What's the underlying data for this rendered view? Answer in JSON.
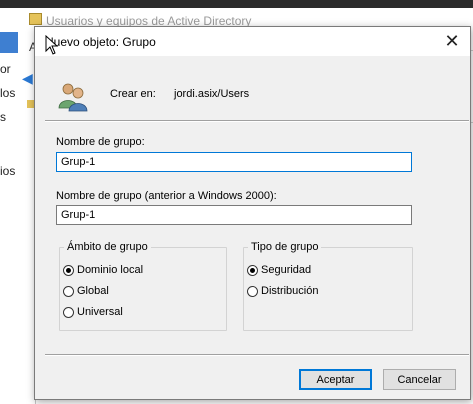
{
  "background": {
    "window_title": "Usuarios y equipos de Active Directory",
    "menu_fragment": "A",
    "left_fragments": [
      "or",
      "los",
      "s",
      "ios"
    ]
  },
  "dialog": {
    "title": "Nuevo objeto: Grupo",
    "create_in_label": "Crear en:",
    "create_in_value": "jordi.asix/Users",
    "group_name": {
      "label": "Nombre de grupo:",
      "value": "Grup-1"
    },
    "group_name_pre2000": {
      "label": "Nombre de grupo (anterior a Windows 2000):",
      "value": "Grup-1"
    },
    "scope": {
      "legend": "Ámbito de grupo",
      "options": [
        {
          "label": "Dominio local",
          "checked": true
        },
        {
          "label": "Global",
          "checked": false
        },
        {
          "label": "Universal",
          "checked": false
        }
      ]
    },
    "type": {
      "legend": "Tipo de grupo",
      "options": [
        {
          "label": "Seguridad",
          "checked": true
        },
        {
          "label": "Distribución",
          "checked": false
        }
      ]
    },
    "buttons": {
      "ok": "Aceptar",
      "cancel": "Cancelar"
    }
  }
}
